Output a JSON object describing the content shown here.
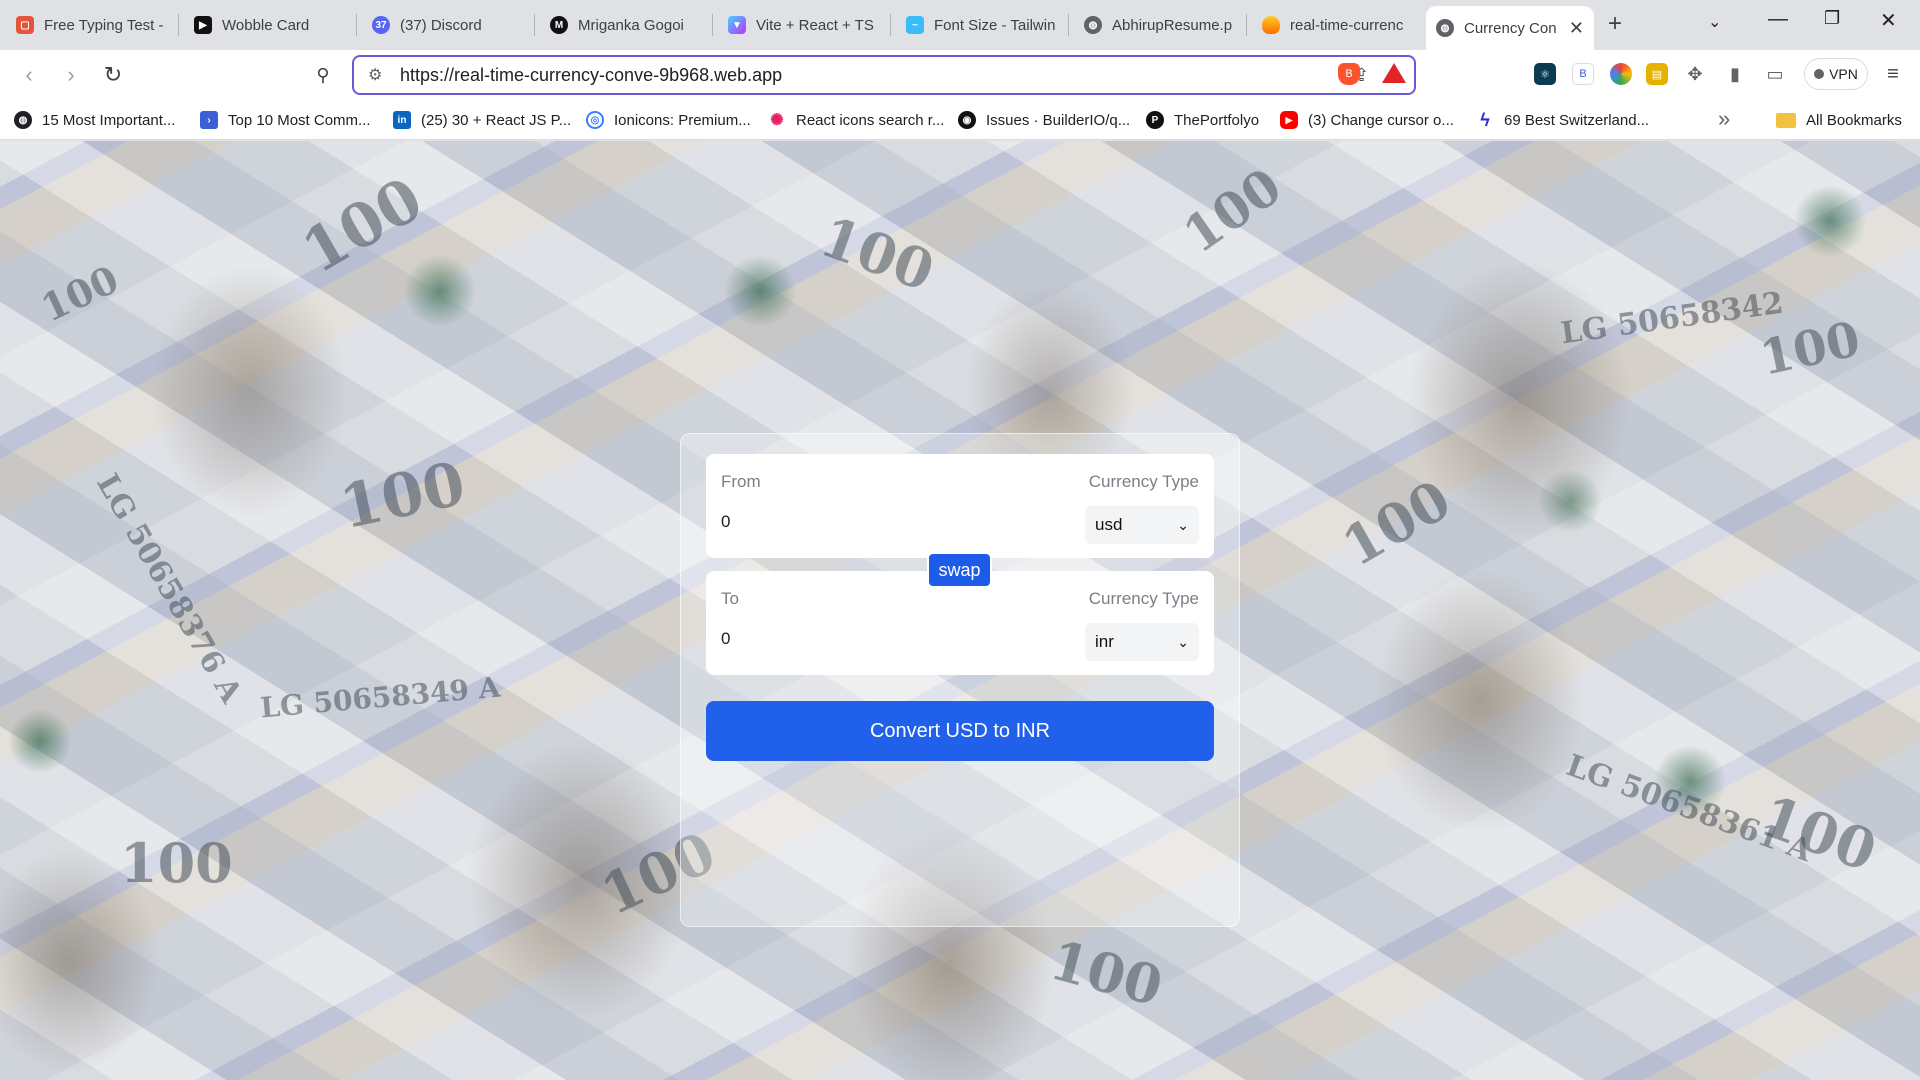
{
  "tabs": [
    {
      "title": "Free Typing Test -",
      "icon": "monkeytype-icon",
      "color": "#e2553c"
    },
    {
      "title": "Wobble Card",
      "icon": "wobble-icon",
      "color": "#111111"
    },
    {
      "title": "(37) Discord",
      "icon": "discord-icon",
      "color": "#5865f2",
      "badge": "37"
    },
    {
      "title": "Mriganka Gogoi",
      "icon": "portfolio-icon",
      "color": "#111111"
    },
    {
      "title": "Vite + React + TS",
      "icon": "vite-icon",
      "color": "#a259ff"
    },
    {
      "title": "Font Size - Tailwin",
      "icon": "tailwind-icon",
      "color": "#38bdf8"
    },
    {
      "title": "AbhirupResume.p",
      "icon": "globe-icon",
      "color": "#5f6368"
    },
    {
      "title": "real-time-currenc",
      "icon": "firebase-icon",
      "color": "#ff6d00"
    },
    {
      "title": "Currency Con",
      "icon": "globe-icon",
      "color": "#5f6368",
      "active": true
    }
  ],
  "toolbar": {
    "url": "https://real-time-currency-conve-9b968.web.app",
    "vpn_label": "VPN"
  },
  "bookmarks": [
    {
      "label": "15 Most Important...",
      "icon": "globe-icon",
      "color": "#202124"
    },
    {
      "label": "Top 10 Most Comm...",
      "icon": "bookmark-blue-icon",
      "color": "#3c5fd6"
    },
    {
      "label": "(25) 30 + React JS P...",
      "icon": "linkedin-icon",
      "color": "#0a66c2"
    },
    {
      "label": "Ionicons: Premium...",
      "icon": "ionicons-icon",
      "color": "#3880ff"
    },
    {
      "label": "React icons search r...",
      "icon": "react-icon",
      "color": "#e91e63"
    },
    {
      "label": "Issues · BuilderIO/q...",
      "icon": "github-icon",
      "color": "#111111"
    },
    {
      "label": "ThePortfolyo",
      "icon": "portfolyo-icon",
      "color": "#111111"
    },
    {
      "label": "(3) Change cursor o...",
      "icon": "youtube-icon",
      "color": "#ff0000"
    },
    {
      "label": "69 Best Switzerland...",
      "icon": "bolt-icon",
      "color": "#2d2dd6"
    }
  ],
  "all_bookmarks": "All Bookmarks",
  "converter": {
    "from_label": "From",
    "to_label": "To",
    "currency_type_label": "Currency Type",
    "from_amount": "0",
    "to_amount": "0",
    "from_currency": "usd",
    "to_currency": "inr",
    "swap_label": "swap",
    "convert_label": "Convert USD to INR"
  },
  "colors": {
    "accent": "#2160ea",
    "omnibox_border": "#6b5bd8"
  }
}
